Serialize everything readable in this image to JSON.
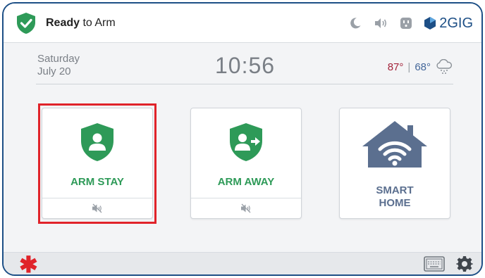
{
  "status": {
    "strong": "Ready",
    "rest": " to Arm"
  },
  "header": {
    "brand": "2GIG",
    "icons": [
      "moon-icon",
      "speaker-icon",
      "outlet-icon",
      "brand-logo-icon"
    ]
  },
  "info": {
    "day": "Saturday",
    "date": "July 20",
    "time": "10:56",
    "temp_high": "87°",
    "temp_sep": "|",
    "temp_low": "68°",
    "weather_icon": "snow-cloud-icon"
  },
  "tiles": [
    {
      "label": "ARM STAY",
      "icon": "shield-person-icon",
      "footer_icon": "speaker-muted-icon",
      "selected": true
    },
    {
      "label": "ARM AWAY",
      "icon": "shield-person-arrow-icon",
      "footer_icon": "speaker-muted-icon",
      "selected": false
    },
    {
      "label_line1": "SMART",
      "label_line2": "HOME",
      "icon": "wifi-house-icon"
    }
  ],
  "bottom": {
    "left_icon": "asterisk-icon",
    "right_icons": [
      "keyboard-icon",
      "gear-icon"
    ]
  },
  "colors": {
    "accent_green": "#2e9a58",
    "selection_red": "#e0232a",
    "frame_blue": "#1d4f86",
    "home_slate": "#5b6f8f"
  }
}
